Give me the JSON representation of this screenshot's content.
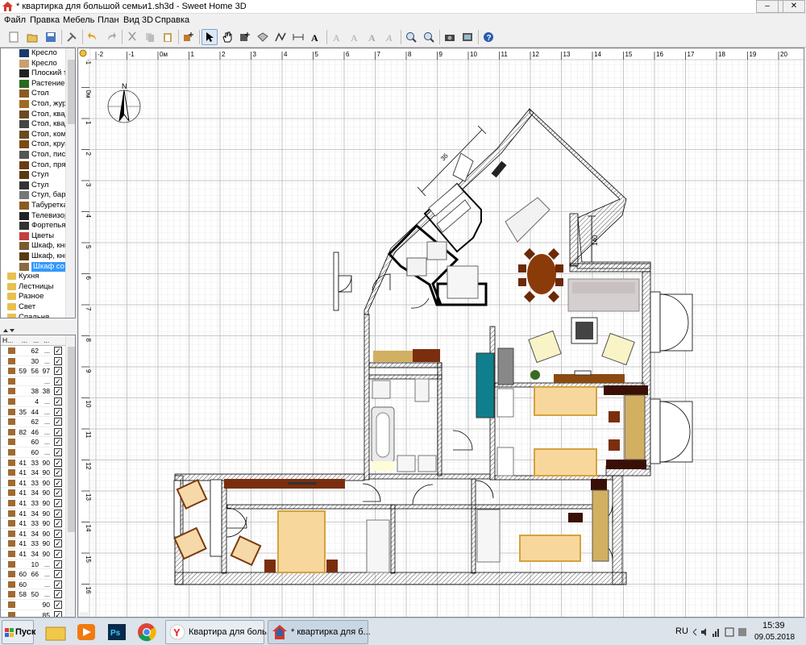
{
  "window": {
    "title": "* квартирка для большой семьи1.sh3d - Sweet Home 3D"
  },
  "menu": [
    "Файл",
    "Правка",
    "Мебель",
    "План",
    "Вид 3D",
    "Справка"
  ],
  "catalog": {
    "items": [
      {
        "label": "Кресло",
        "type": "item"
      },
      {
        "label": "Кресло",
        "type": "item"
      },
      {
        "label": "Плоский те",
        "type": "item"
      },
      {
        "label": "Растение",
        "type": "item"
      },
      {
        "label": "Стол",
        "type": "item"
      },
      {
        "label": "Стол, жур",
        "type": "item"
      },
      {
        "label": "Стол, квад",
        "type": "item"
      },
      {
        "label": "Стол, квад",
        "type": "item"
      },
      {
        "label": "Стол, комп",
        "type": "item"
      },
      {
        "label": "Стол, круг",
        "type": "item"
      },
      {
        "label": "Стол, писы",
        "type": "item"
      },
      {
        "label": "Стол, прям",
        "type": "item"
      },
      {
        "label": "Стул",
        "type": "item"
      },
      {
        "label": "Стул",
        "type": "item"
      },
      {
        "label": "Стул, барн",
        "type": "item"
      },
      {
        "label": "Табуретка",
        "type": "item"
      },
      {
        "label": "Телевизор",
        "type": "item"
      },
      {
        "label": "Фортепьян",
        "type": "item"
      },
      {
        "label": "Цветы",
        "type": "item"
      },
      {
        "label": "Шкаф, кни",
        "type": "item"
      },
      {
        "label": "Шкаф, кни",
        "type": "item"
      },
      {
        "label": "Шкаф со с",
        "type": "item",
        "selected": true
      },
      {
        "label": "Кухня",
        "type": "folder"
      },
      {
        "label": "Лестницы",
        "type": "folder"
      },
      {
        "label": "Разное",
        "type": "folder"
      },
      {
        "label": "Свет",
        "type": "folder"
      },
      {
        "label": "Спальня",
        "type": "folder"
      }
    ]
  },
  "furniture_table": {
    "headers": [
      "Н...",
      "...",
      "...",
      "..."
    ],
    "rows": [
      [
        "",
        "62",
        "...",
        true
      ],
      [
        "",
        "30",
        "...",
        true
      ],
      [
        "59",
        "56",
        "97",
        true
      ],
      [
        "",
        "",
        "...",
        true
      ],
      [
        "",
        "38",
        "38",
        true
      ],
      [
        "",
        "4",
        "...",
        true
      ],
      [
        "35",
        "44",
        "...",
        true
      ],
      [
        "",
        "62",
        "...",
        true
      ],
      [
        "82",
        "46",
        "...",
        true
      ],
      [
        "",
        "60",
        "...",
        true
      ],
      [
        "",
        "60",
        "...",
        true
      ],
      [
        "41",
        "33",
        "90",
        true
      ],
      [
        "41",
        "34",
        "90",
        true
      ],
      [
        "41",
        "33",
        "90",
        true
      ],
      [
        "41",
        "34",
        "90",
        true
      ],
      [
        "41",
        "33",
        "90",
        true
      ],
      [
        "41",
        "34",
        "90",
        true
      ],
      [
        "41",
        "33",
        "90",
        true
      ],
      [
        "41",
        "34",
        "90",
        true
      ],
      [
        "41",
        "33",
        "90",
        true
      ],
      [
        "41",
        "34",
        "90",
        true
      ],
      [
        "",
        "10",
        "...",
        true
      ],
      [
        "60",
        "66",
        "...",
        true
      ],
      [
        "60",
        "",
        "...",
        true
      ],
      [
        "58",
        "50",
        "...",
        true
      ],
      [
        "",
        "",
        "90",
        true
      ],
      [
        "",
        "",
        "85",
        true
      ]
    ]
  },
  "plan": {
    "ruler_top": [
      "-2",
      "-1",
      "0м",
      "1",
      "2",
      "3",
      "4",
      "5",
      "6",
      "7",
      "8",
      "9",
      "10",
      "11",
      "12",
      "13",
      "14",
      "15",
      "16",
      "17",
      "18",
      "19",
      "20"
    ],
    "ruler_left": [
      "-1",
      "0м",
      "1",
      "2",
      "3",
      "4",
      "5",
      "6",
      "7",
      "8",
      "9",
      "10",
      "11",
      "12",
      "13",
      "14",
      "15",
      "16"
    ],
    "dimension_1": "3б",
    "dimension_2": "140",
    "compass_label": "N"
  },
  "taskbar": {
    "start": "Пуск",
    "tasks": [
      "Квартира для боль...",
      "* квартирка для б..."
    ],
    "lang": "RU",
    "time": "15:39",
    "date": "09.05.2018"
  }
}
